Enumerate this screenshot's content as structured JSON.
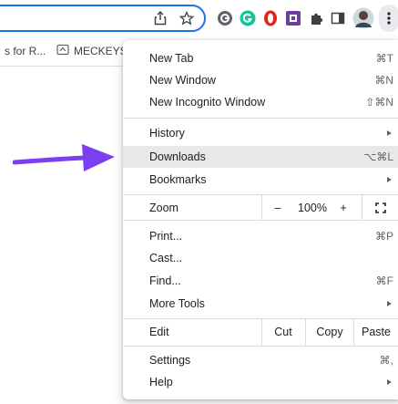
{
  "toolbar": {
    "icons": [
      "share-icon",
      "star-icon",
      "extension-g-icon",
      "grammarly-icon",
      "opera-icon",
      "ext-box-icon",
      "puzzle-icon",
      "sidebar-icon",
      "profile-avatar",
      "menu-dots-icon"
    ]
  },
  "bookmarks": {
    "item1": "s for R...",
    "item2": "MECKEYS"
  },
  "menu": {
    "new_tab": {
      "label": "New Tab",
      "shortcut": "⌘T"
    },
    "new_window": {
      "label": "New Window",
      "shortcut": "⌘N"
    },
    "new_incognito": {
      "label": "New Incognito Window",
      "shortcut": "⇧⌘N"
    },
    "history": {
      "label": "History"
    },
    "downloads": {
      "label": "Downloads",
      "shortcut": "⌥⌘L"
    },
    "bookmarks": {
      "label": "Bookmarks"
    },
    "zoom": {
      "label": "Zoom",
      "minus": "–",
      "level": "100%",
      "plus": "+"
    },
    "print": {
      "label": "Print...",
      "shortcut": "⌘P"
    },
    "cast": {
      "label": "Cast..."
    },
    "find": {
      "label": "Find...",
      "shortcut": "⌘F"
    },
    "more_tools": {
      "label": "More Tools"
    },
    "edit": {
      "label": "Edit",
      "cut": "Cut",
      "copy": "Copy",
      "paste": "Paste"
    },
    "settings": {
      "label": "Settings",
      "shortcut": "⌘,"
    },
    "help": {
      "label": "Help"
    }
  },
  "colors": {
    "accent": "#1a73e8",
    "arrow": "#7b3ff2",
    "highlight": "#e8e8e8"
  }
}
